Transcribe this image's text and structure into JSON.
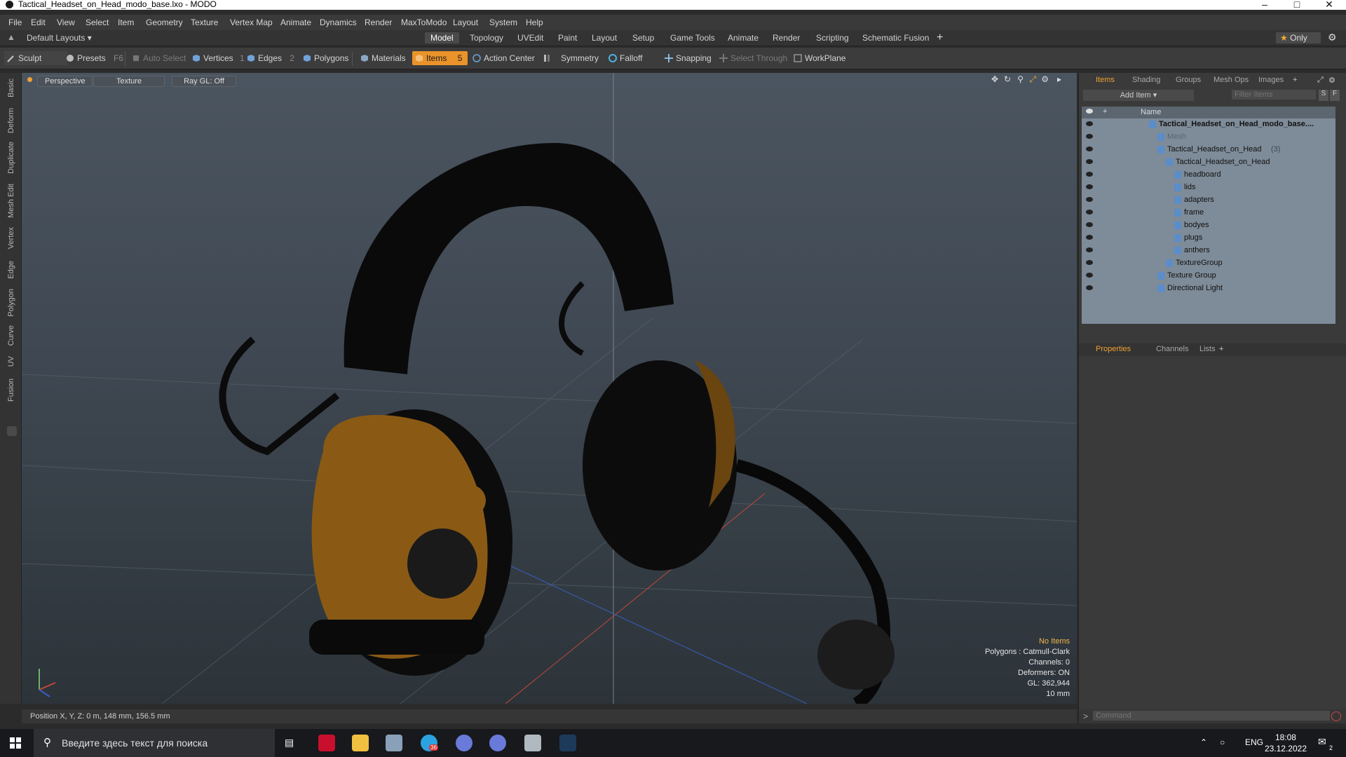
{
  "window": {
    "title": "Tactical_Headset_on_Head_modo_base.lxo - MODO"
  },
  "menu": [
    "File",
    "Edit",
    "View",
    "Select",
    "Item",
    "Geometry",
    "Texture",
    "Vertex Map",
    "Animate",
    "Dynamics",
    "Render",
    "MaxToModo",
    "Layout",
    "System",
    "Help"
  ],
  "layout": {
    "default_layouts": "Default Layouts",
    "tabs": [
      "Model",
      "Topology",
      "UVEdit",
      "Paint",
      "Layout",
      "Setup",
      "Game Tools",
      "Animate",
      "Render",
      "Scripting",
      "Schematic Fusion"
    ],
    "active_tab": "Model",
    "only_label": "Only"
  },
  "toolbar": {
    "sculpt": "Sculpt",
    "presets": "Presets",
    "presets_key": "F6",
    "auto_select": "Auto Select",
    "vertices": "Vertices",
    "vertices_count": "1",
    "edges": "Edges",
    "edges_count": "2",
    "polygons": "Polygons",
    "materials": "Materials",
    "items": "Items",
    "items_count": "5",
    "action_center": "Action Center",
    "symmetry": "Symmetry",
    "falloff": "Falloff",
    "snapping": "Snapping",
    "select_through": "Select Through",
    "workplane": "WorkPlane"
  },
  "left_tabs": [
    "Basic",
    "Deform",
    "Duplicate",
    "Mesh Edit",
    "Vertex",
    "Edge",
    "Polygon",
    "Curve",
    "UV",
    "Fusion"
  ],
  "viewport": {
    "tabs": [
      "Perspective",
      "Texture",
      "Ray GL: Off"
    ],
    "info": {
      "no_items": "No Items",
      "polygons": "Polygons : Catmull-Clark",
      "channels": "Channels: 0",
      "deformers": "Deformers: ON",
      "gl": "GL: 362,944",
      "scale": "10 mm"
    }
  },
  "status": {
    "position": "Position X, Y, Z:  0 m, 148 mm, 156.5 mm"
  },
  "right_panel": {
    "tabs": [
      "Items",
      "Shading",
      "Groups",
      "Mesh Ops",
      "Images"
    ],
    "add_item": "Add Item",
    "filter_placeholder": "Filter Items",
    "column_name": "Name",
    "tree": [
      {
        "label": "Tactical_Headset_on_Head_modo_base....",
        "indent": 0,
        "bold": true
      },
      {
        "label": "Mesh",
        "indent": 1,
        "dim": true
      },
      {
        "label": "Tactical_Headset_on_Head",
        "count": "(3)",
        "indent": 1
      },
      {
        "label": "Tactical_Headset_on_Head",
        "indent": 2
      },
      {
        "label": "headboard",
        "indent": 3
      },
      {
        "label": "lids",
        "indent": 3
      },
      {
        "label": "adapters",
        "indent": 3
      },
      {
        "label": "frame",
        "indent": 3
      },
      {
        "label": "bodyes",
        "indent": 3
      },
      {
        "label": "plugs",
        "indent": 3
      },
      {
        "label": "anthers",
        "indent": 3
      },
      {
        "label": "TextureGroup",
        "indent": 2
      },
      {
        "label": "Texture Group",
        "indent": 1
      },
      {
        "label": "Directional Light",
        "indent": 1
      }
    ],
    "bottom_tabs": [
      "Properties",
      "Channels",
      "Lists"
    ],
    "command_placeholder": "Command"
  },
  "taskbar": {
    "search_text": "Введите здесь текст для поиска",
    "lang": "ENG",
    "time": "18:08",
    "date": "23.12.2022",
    "telegram_badge": "36",
    "notif_count": "2"
  }
}
